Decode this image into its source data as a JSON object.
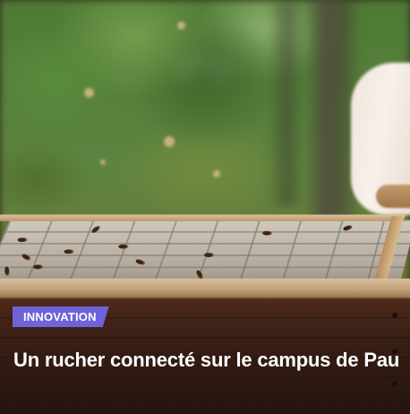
{
  "article": {
    "category": "INNOVATION",
    "title": "Un rucher connecté sur le campus de Pau",
    "badge_color": "#6f63d9"
  },
  "image": {
    "subject": "beehive-frame-photo"
  }
}
